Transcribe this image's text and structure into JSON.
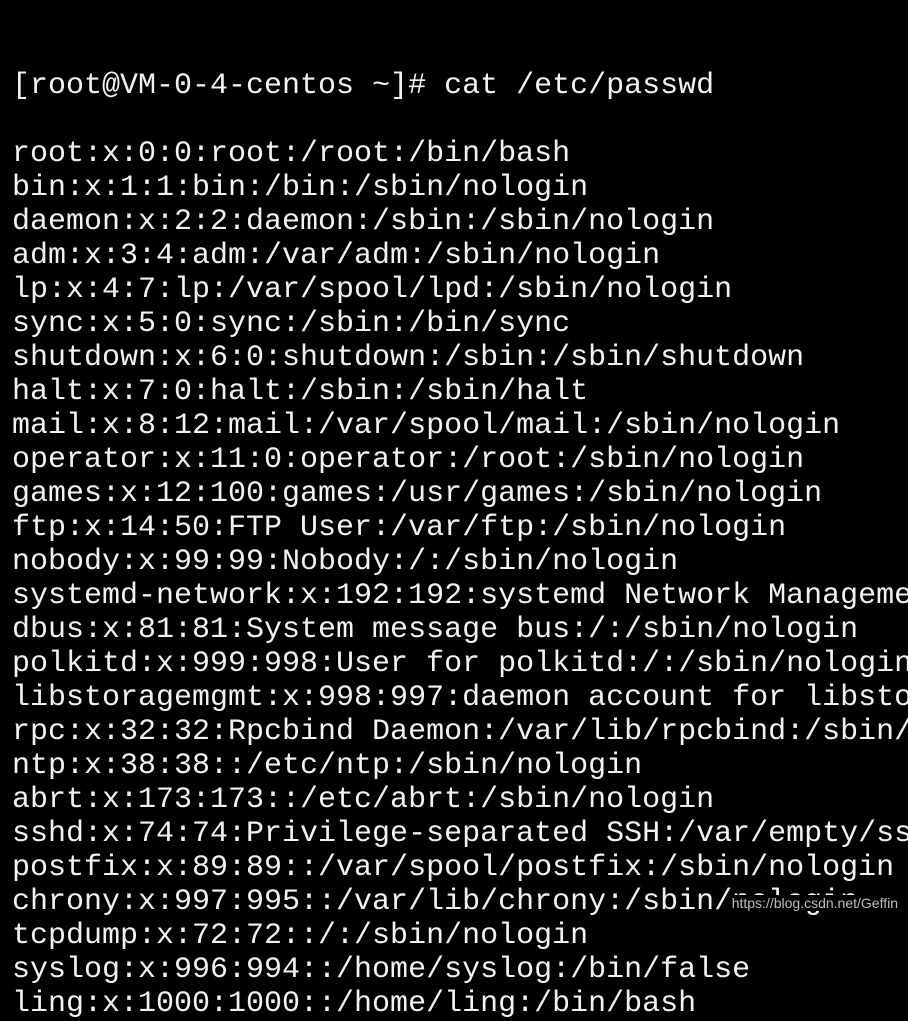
{
  "terminal": {
    "prompt": "[root@VM-0-4-centos ~]# cat /etc/passwd",
    "lines": [
      "root:x:0:0:root:/root:/bin/bash",
      "bin:x:1:1:bin:/bin:/sbin/nologin",
      "daemon:x:2:2:daemon:/sbin:/sbin/nologin",
      "adm:x:3:4:adm:/var/adm:/sbin/nologin",
      "lp:x:4:7:lp:/var/spool/lpd:/sbin/nologin",
      "sync:x:5:0:sync:/sbin:/bin/sync",
      "shutdown:x:6:0:shutdown:/sbin:/sbin/shutdown",
      "halt:x:7:0:halt:/sbin:/sbin/halt",
      "mail:x:8:12:mail:/var/spool/mail:/sbin/nologin",
      "operator:x:11:0:operator:/root:/sbin/nologin",
      "games:x:12:100:games:/usr/games:/sbin/nologin",
      "ftp:x:14:50:FTP User:/var/ftp:/sbin/nologin",
      "nobody:x:99:99:Nobody:/:/sbin/nologin",
      "systemd-network:x:192:192:systemd Network Manageme",
      "dbus:x:81:81:System message bus:/:/sbin/nologin",
      "polkitd:x:999:998:User for polkitd:/:/sbin/nologin",
      "libstoragemgmt:x:998:997:daemon account for libsto",
      "rpc:x:32:32:Rpcbind Daemon:/var/lib/rpcbind:/sbin/",
      "ntp:x:38:38::/etc/ntp:/sbin/nologin",
      "abrt:x:173:173::/etc/abrt:/sbin/nologin",
      "sshd:x:74:74:Privilege-separated SSH:/var/empty/ss",
      "postfix:x:89:89::/var/spool/postfix:/sbin/nologin",
      "chrony:x:997:995::/var/lib/chrony:/sbin/nologin",
      "tcpdump:x:72:72::/:/sbin/nologin",
      "syslog:x:996:994::/home/syslog:/bin/false",
      "ling:x:1000:1000::/home/ling:/bin/bash"
    ]
  },
  "watermark": "https://blog.csdn.net/Geffin",
  "colors": {
    "background": "#000000",
    "text": "#f2f2f2"
  }
}
